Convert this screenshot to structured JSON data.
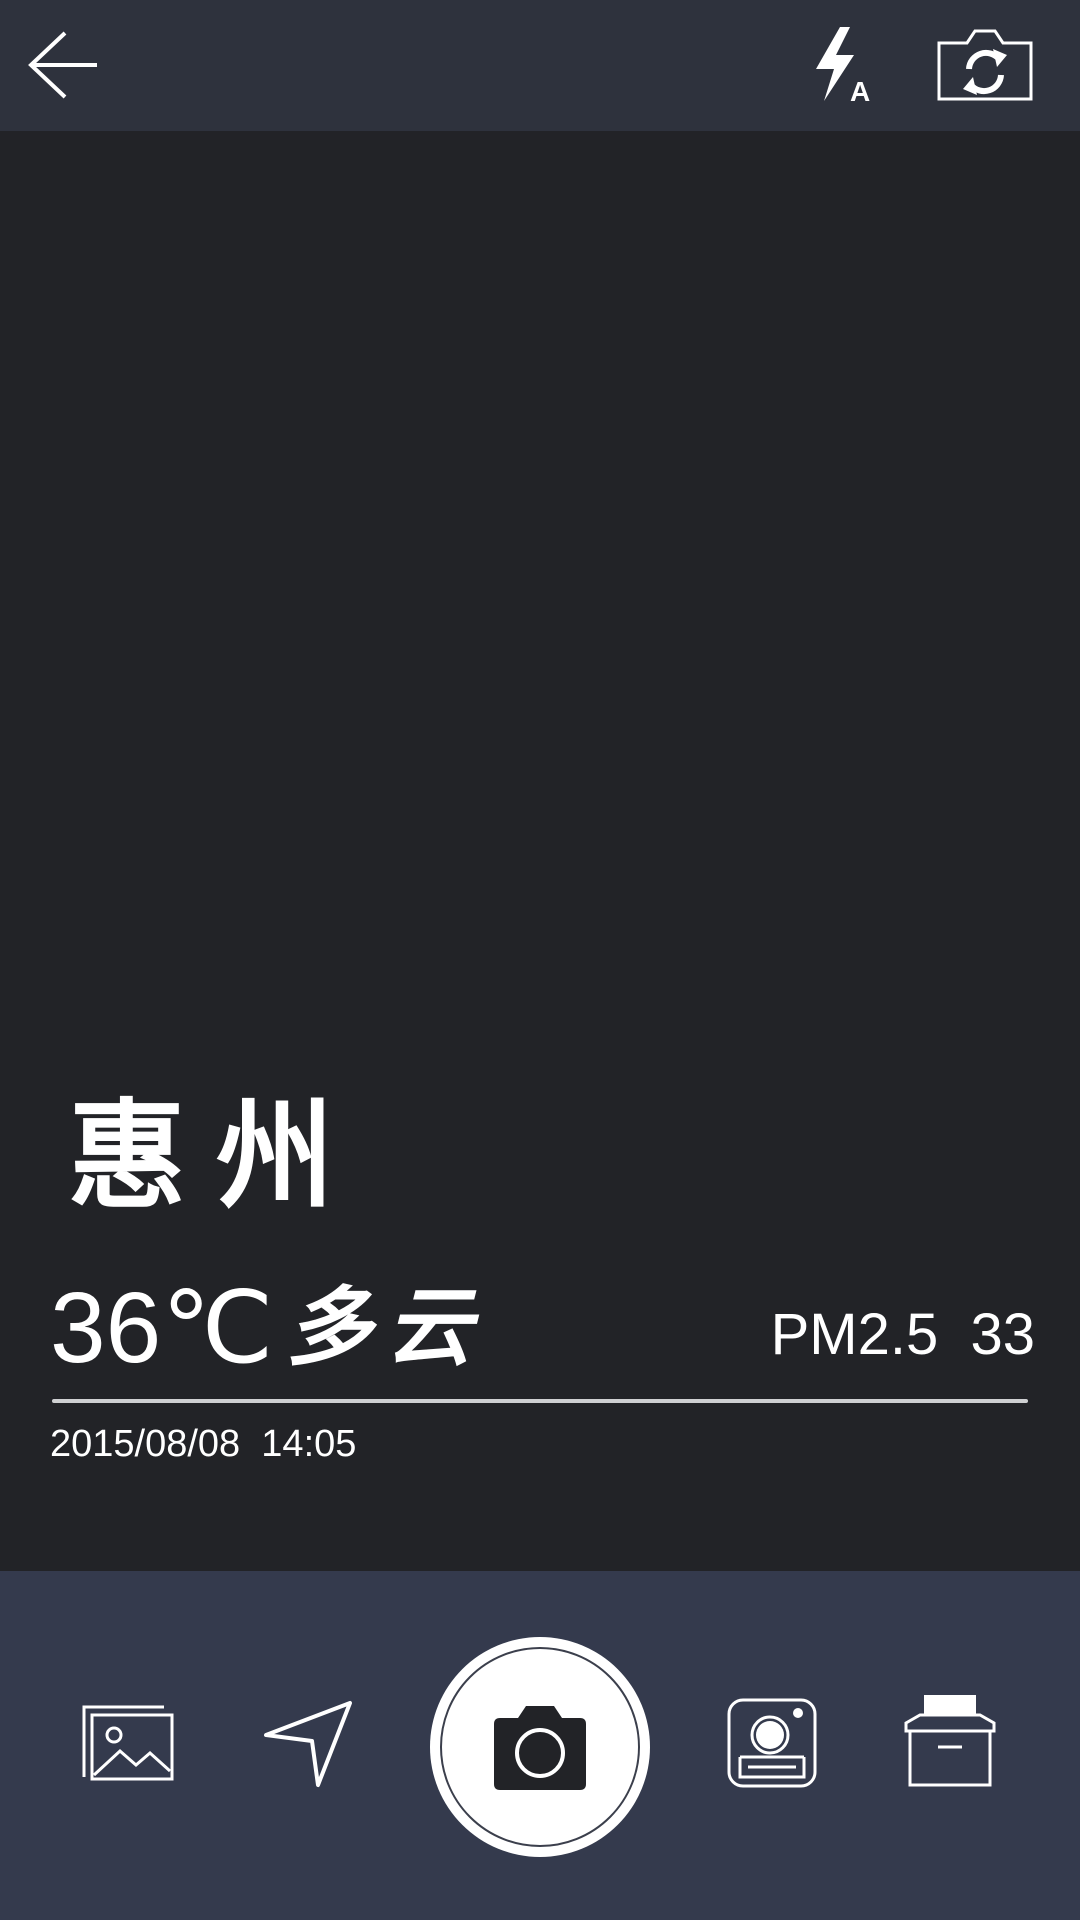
{
  "header": {
    "back_icon": "arrow-left-icon",
    "flash_icon": "flash-auto-icon",
    "switch_icon": "camera-switch-icon"
  },
  "watermark": {
    "city": "惠州",
    "temperature": "36℃",
    "weather": "多云",
    "pm_label": "PM2.5  33",
    "datetime": "2015/08/08  14:05"
  },
  "footer": {
    "gallery_icon": "gallery-icon",
    "location_icon": "location-arrow-icon",
    "shutter_icon": "camera-icon",
    "stamp_icon": "stamp-icon",
    "print_icon": "printer-icon"
  },
  "colors": {
    "top_bar": "#2e323d",
    "viewfinder": "#222327",
    "bottom_bar": "#343a4d",
    "foreground": "#ffffff"
  }
}
